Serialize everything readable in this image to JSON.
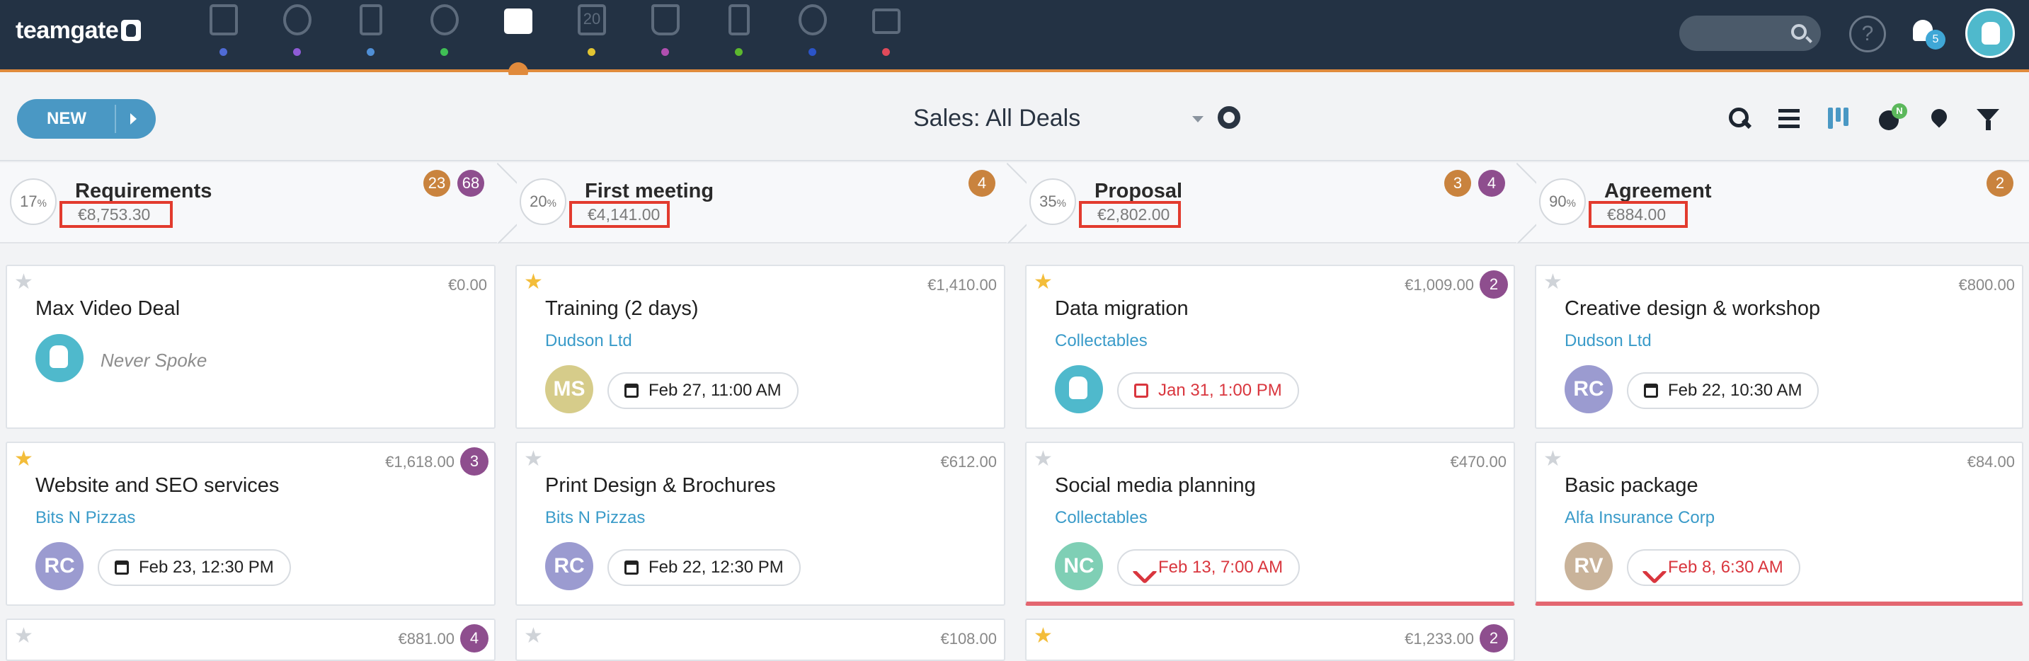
{
  "app": {
    "logo_text": "teamgate",
    "notifications_count": "5",
    "active_nav": "deals-briefcase-icon"
  },
  "nav_icons": [
    {
      "name": "dashboard-icon",
      "dot_color": "#4f6bd6"
    },
    {
      "name": "target-icon",
      "dot_color": "#8e5bd6"
    },
    {
      "name": "companies-icon",
      "dot_color": "#4f8fd6"
    },
    {
      "name": "people-icon",
      "dot_color": "#3fbf55"
    },
    {
      "name": "deals-briefcase-icon",
      "dot_color": "#e08a3c"
    },
    {
      "name": "calendar-icon",
      "dot_color": "#e2c532",
      "label": "20"
    },
    {
      "name": "leads-icon",
      "dot_color": "#b04fb0"
    },
    {
      "name": "files-icon",
      "dot_color": "#5cb82e"
    },
    {
      "name": "reports-pie-icon",
      "dot_color": "#2b54c8"
    },
    {
      "name": "mail-icon",
      "dot_color": "#e04a5a"
    }
  ],
  "toolbar": {
    "new_label": "NEW",
    "view_title": "Sales: All Deals",
    "badge_n": "N"
  },
  "stages": [
    {
      "percent": "17",
      "name": "Requirements",
      "amount": "€8,753.30",
      "counts": [
        "23",
        "68"
      ]
    },
    {
      "percent": "20",
      "name": "First meeting",
      "amount": "€4,141.00",
      "counts": [
        "4"
      ]
    },
    {
      "percent": "35",
      "name": "Proposal",
      "amount": "€2,802.00",
      "counts": [
        "3",
        "4"
      ]
    },
    {
      "percent": "90",
      "name": "Agreement",
      "amount": "€884.00",
      "counts": [
        "2"
      ]
    }
  ],
  "cards": [
    {
      "title": "Max Video Deal",
      "amount": "€0.00",
      "starred": false,
      "company": "",
      "avatar": "",
      "status": "Never Spoke"
    },
    {
      "title": "Training (2 days)",
      "amount": "€1,410.00",
      "starred": true,
      "company": "Dudson Ltd",
      "avatar": "MS",
      "activity": "Feb 27, 11:00 AM"
    },
    {
      "title": "Data migration",
      "amount": "€1,009.00",
      "badge": "2",
      "starred": true,
      "company": "Collectables",
      "avatar": "",
      "activity": "Jan 31, 1:00 PM"
    },
    {
      "title": "Creative design & workshop",
      "amount": "€800.00",
      "starred": false,
      "company": "Dudson Ltd",
      "avatar": "RC",
      "activity": "Feb 22, 10:30 AM"
    },
    {
      "title": "Website and SEO services",
      "amount": "€1,618.00",
      "badge": "3",
      "starred": true,
      "company": "Bits N Pizzas",
      "avatar": "RC",
      "activity": "Feb 23, 12:30 PM"
    },
    {
      "title": "Print Design & Brochures",
      "amount": "€612.00",
      "starred": false,
      "company": "Bits N Pizzas",
      "avatar": "RC",
      "activity": "Feb 22, 12:30 PM"
    },
    {
      "title": "Social media planning",
      "amount": "€470.00",
      "starred": false,
      "company": "Collectables",
      "avatar": "NC",
      "activity": "Feb 13, 7:00 AM"
    },
    {
      "title": "Basic package",
      "amount": "€84.00",
      "starred": false,
      "company": "Alfa Insurance Corp",
      "avatar": "RV",
      "activity": "Feb 8, 6:30 AM"
    }
  ],
  "partial_row": [
    {
      "amount": "€881.00",
      "badge": "4"
    },
    {
      "amount": "€108.00"
    },
    {
      "amount": "€1,233.00",
      "badge": "2"
    }
  ]
}
